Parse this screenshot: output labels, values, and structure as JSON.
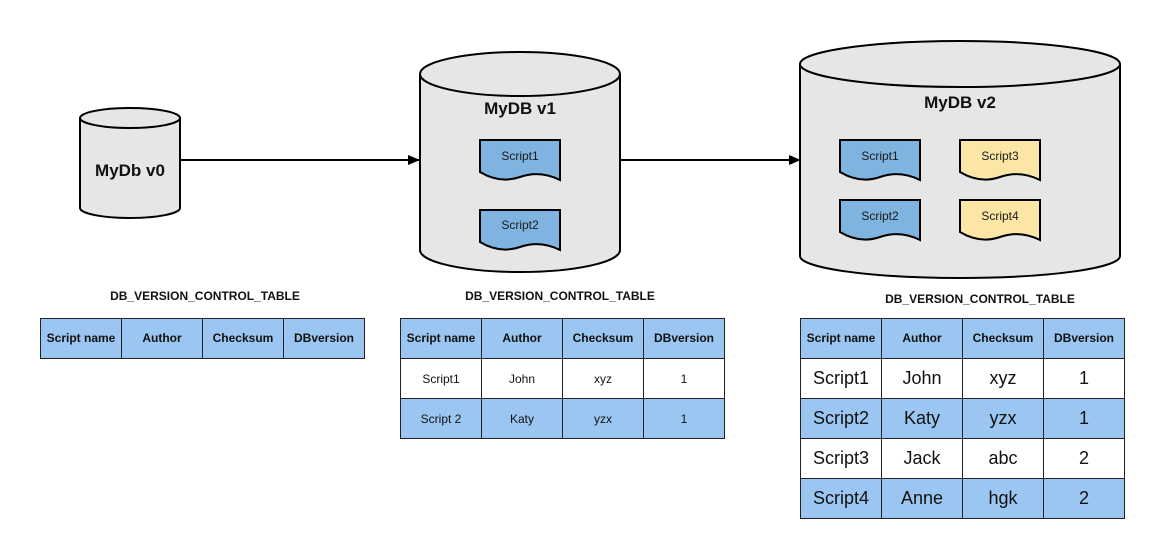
{
  "colors": {
    "cylinder_fill": "#e6e6e6",
    "existing_script_fill": "#7fb3e0",
    "new_script_fill": "#fbe6a6",
    "table_header_fill": "#9cc6f2",
    "table_alt_row_fill": "#9cc6f2"
  },
  "databases": [
    {
      "label": "MyDb v0",
      "scripts": []
    },
    {
      "label": "MyDB v1",
      "scripts": [
        {
          "label": "Script1",
          "status": "existing"
        },
        {
          "label": "Script2",
          "status": "existing"
        }
      ]
    },
    {
      "label": "MyDB v2",
      "scripts": [
        {
          "label": "Script1",
          "status": "existing"
        },
        {
          "label": "Script3",
          "status": "new"
        },
        {
          "label": "Script2",
          "status": "existing"
        },
        {
          "label": "Script4",
          "status": "new"
        }
      ]
    }
  ],
  "arrows": [
    {
      "from": "MyDb v0",
      "to": "MyDB v1"
    },
    {
      "from": "MyDB v1",
      "to": "MyDB v2"
    }
  ],
  "tables": [
    {
      "title": "DB_VERSION_CONTROL_TABLE",
      "headers": [
        "Script name",
        "Author",
        "Checksum",
        "DBversion"
      ],
      "rows": []
    },
    {
      "title": "DB_VERSION_CONTROL_TABLE",
      "headers": [
        "Script name",
        "Author",
        "Checksum",
        "DBversion"
      ],
      "rows": [
        [
          "Script1",
          "John",
          "xyz",
          "1"
        ],
        [
          "Script 2",
          "Katy",
          "yzx",
          "1"
        ]
      ]
    },
    {
      "title": "DB_VERSION_CONTROL_TABLE",
      "headers": [
        "Script name",
        "Author",
        "Checksum",
        "DBversion"
      ],
      "rows": [
        [
          "Script1",
          "John",
          "xyz",
          "1"
        ],
        [
          "Script2",
          "Katy",
          "yzx",
          "1"
        ],
        [
          "Script3",
          "Jack",
          "abc",
          "2"
        ],
        [
          "Script4",
          "Anne",
          "hgk",
          "2"
        ]
      ]
    }
  ]
}
